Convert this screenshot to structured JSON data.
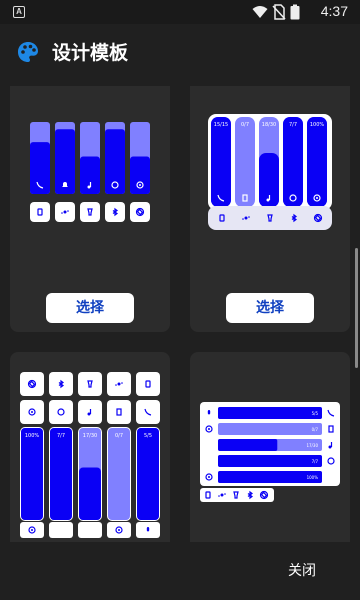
{
  "status_bar": {
    "app_icon_letter": "A",
    "time": "4:37",
    "icons": [
      "wifi-icon",
      "no-sim-icon",
      "battery-icon"
    ]
  },
  "app_bar": {
    "icon": "palette-icon",
    "title": "设计模板"
  },
  "templates": [
    {
      "id": "template-1",
      "select_label": "选择",
      "sliders": [
        {
          "icon": "phone-icon",
          "fill": 0.72
        },
        {
          "icon": "bell-icon",
          "fill": 0.9
        },
        {
          "icon": "music-icon",
          "fill": 0.52
        },
        {
          "icon": "alarm-icon",
          "fill": 0.9
        },
        {
          "icon": "gear-icon",
          "fill": 0.52
        }
      ],
      "buttons": [
        "portrait-icon",
        "bluetooth-dots-icon",
        "flashlight-icon",
        "bluetooth-icon",
        "rotate-icon"
      ]
    },
    {
      "id": "template-2",
      "select_label": "选择",
      "sliders": [
        {
          "icon": "phone-icon",
          "value": "15/15",
          "fill": 1.0
        },
        {
          "icon": "vibrate-icon",
          "value": "0/7",
          "fill": 0.0
        },
        {
          "icon": "music-icon",
          "value": "18/30",
          "fill": 0.6
        },
        {
          "icon": "alarm-icon",
          "value": "7/7",
          "fill": 1.0
        },
        {
          "icon": "gear-icon",
          "value": "100%",
          "fill": 1.0
        }
      ],
      "buttons": [
        "portrait-icon",
        "bluetooth-dots-icon",
        "flashlight-icon",
        "bluetooth-icon",
        "rotate-icon"
      ]
    },
    {
      "id": "template-3",
      "buttons_row1": [
        "rotate-icon",
        "bluetooth-icon",
        "flashlight-icon",
        "bluetooth-dots-icon",
        "portrait-icon"
      ],
      "buttons_row2": [
        "gear-icon",
        "alarm-icon",
        "music-icon",
        "vibrate-icon",
        "phone-icon"
      ],
      "sliders": [
        {
          "icon": "gear-icon",
          "value": "100%",
          "fill": 1.0
        },
        {
          "icon": "",
          "value": "7/7",
          "fill": 1.0
        },
        {
          "icon": "",
          "value": "17/30",
          "fill": 0.57
        },
        {
          "icon": "gear-icon",
          "value": "0/7",
          "fill": 0.0
        },
        {
          "icon": "mic-icon",
          "value": "5/5",
          "fill": 1.0
        }
      ]
    },
    {
      "id": "template-4",
      "rows": [
        {
          "left_icon": "mic-icon",
          "right_icon": "phone-icon",
          "value": "5/5",
          "fill": 1.0
        },
        {
          "left_icon": "gear-icon",
          "right_icon": "vibrate-icon",
          "value": "0/7",
          "fill": 0.0
        },
        {
          "left_icon": "",
          "right_icon": "music-icon",
          "value": "17/30",
          "fill": 0.57
        },
        {
          "left_icon": "",
          "right_icon": "alarm-icon",
          "value": "7/7",
          "fill": 1.0
        },
        {
          "left_icon": "gear-icon",
          "right_icon": "",
          "value": "100%",
          "fill": 1.0
        }
      ],
      "buttons": [
        "portrait-icon",
        "bluetooth-dots-icon",
        "flashlight-icon",
        "bluetooth-icon",
        "rotate-icon"
      ]
    }
  ],
  "footer": {
    "close_label": "关闭"
  },
  "colors": {
    "fill": "#0a00f5",
    "track": "#8080ff",
    "card": "#2c2c2c",
    "background": "#202020",
    "select_text": "#1040c0"
  }
}
